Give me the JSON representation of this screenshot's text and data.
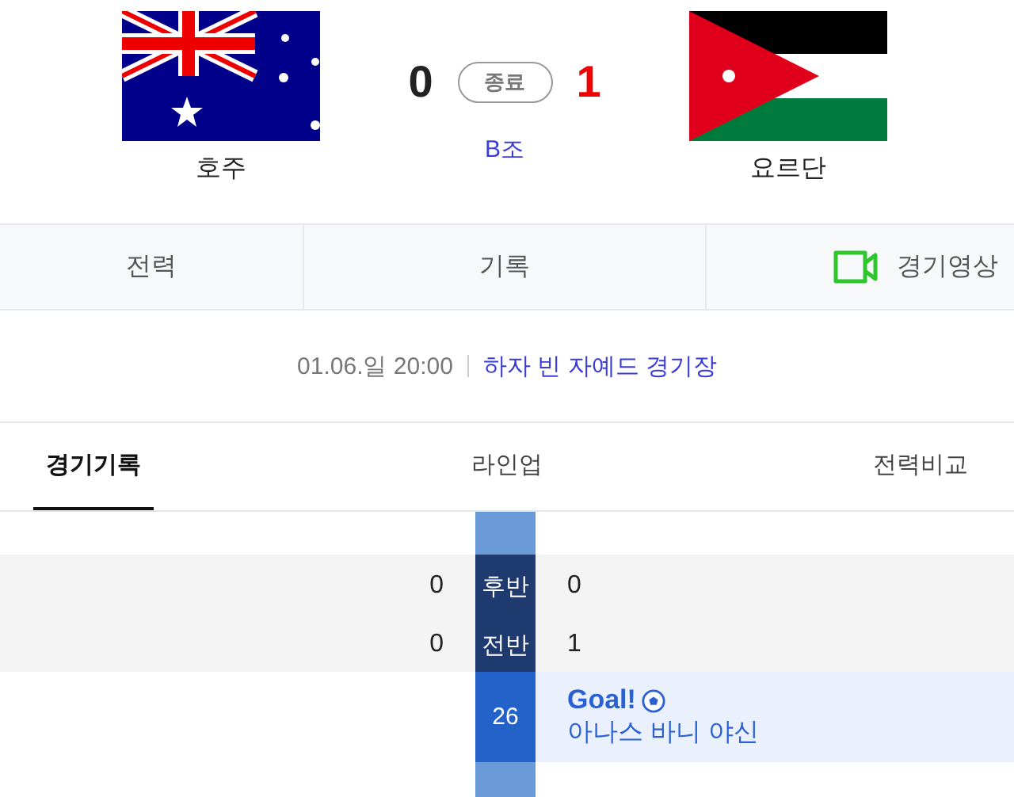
{
  "match": {
    "home": {
      "name": "호주",
      "score": "0",
      "winner": false
    },
    "away": {
      "name": "요르단",
      "score": "1",
      "winner": true
    },
    "status": "종료",
    "group": "B조"
  },
  "top_tabs": [
    {
      "label": "전력",
      "kind": "text"
    },
    {
      "label": "기록",
      "kind": "text"
    },
    {
      "label": "경기영상",
      "kind": "video"
    }
  ],
  "info": {
    "datetime": "01.06.일 20:00",
    "venue": "하자 빈 자예드 경기장"
  },
  "tabs": [
    {
      "label": "경기기록",
      "selected": true
    },
    {
      "label": "라인업",
      "selected": false
    },
    {
      "label": "전력비교",
      "selected": false
    }
  ],
  "periods": [
    {
      "label": "후반",
      "home": "0",
      "away": "0"
    },
    {
      "label": "전반",
      "home": "0",
      "away": "1"
    }
  ],
  "events": [
    {
      "minute": "26",
      "kind": "away",
      "title": "Goal!",
      "player": "아나스 바니 야신"
    }
  ]
}
